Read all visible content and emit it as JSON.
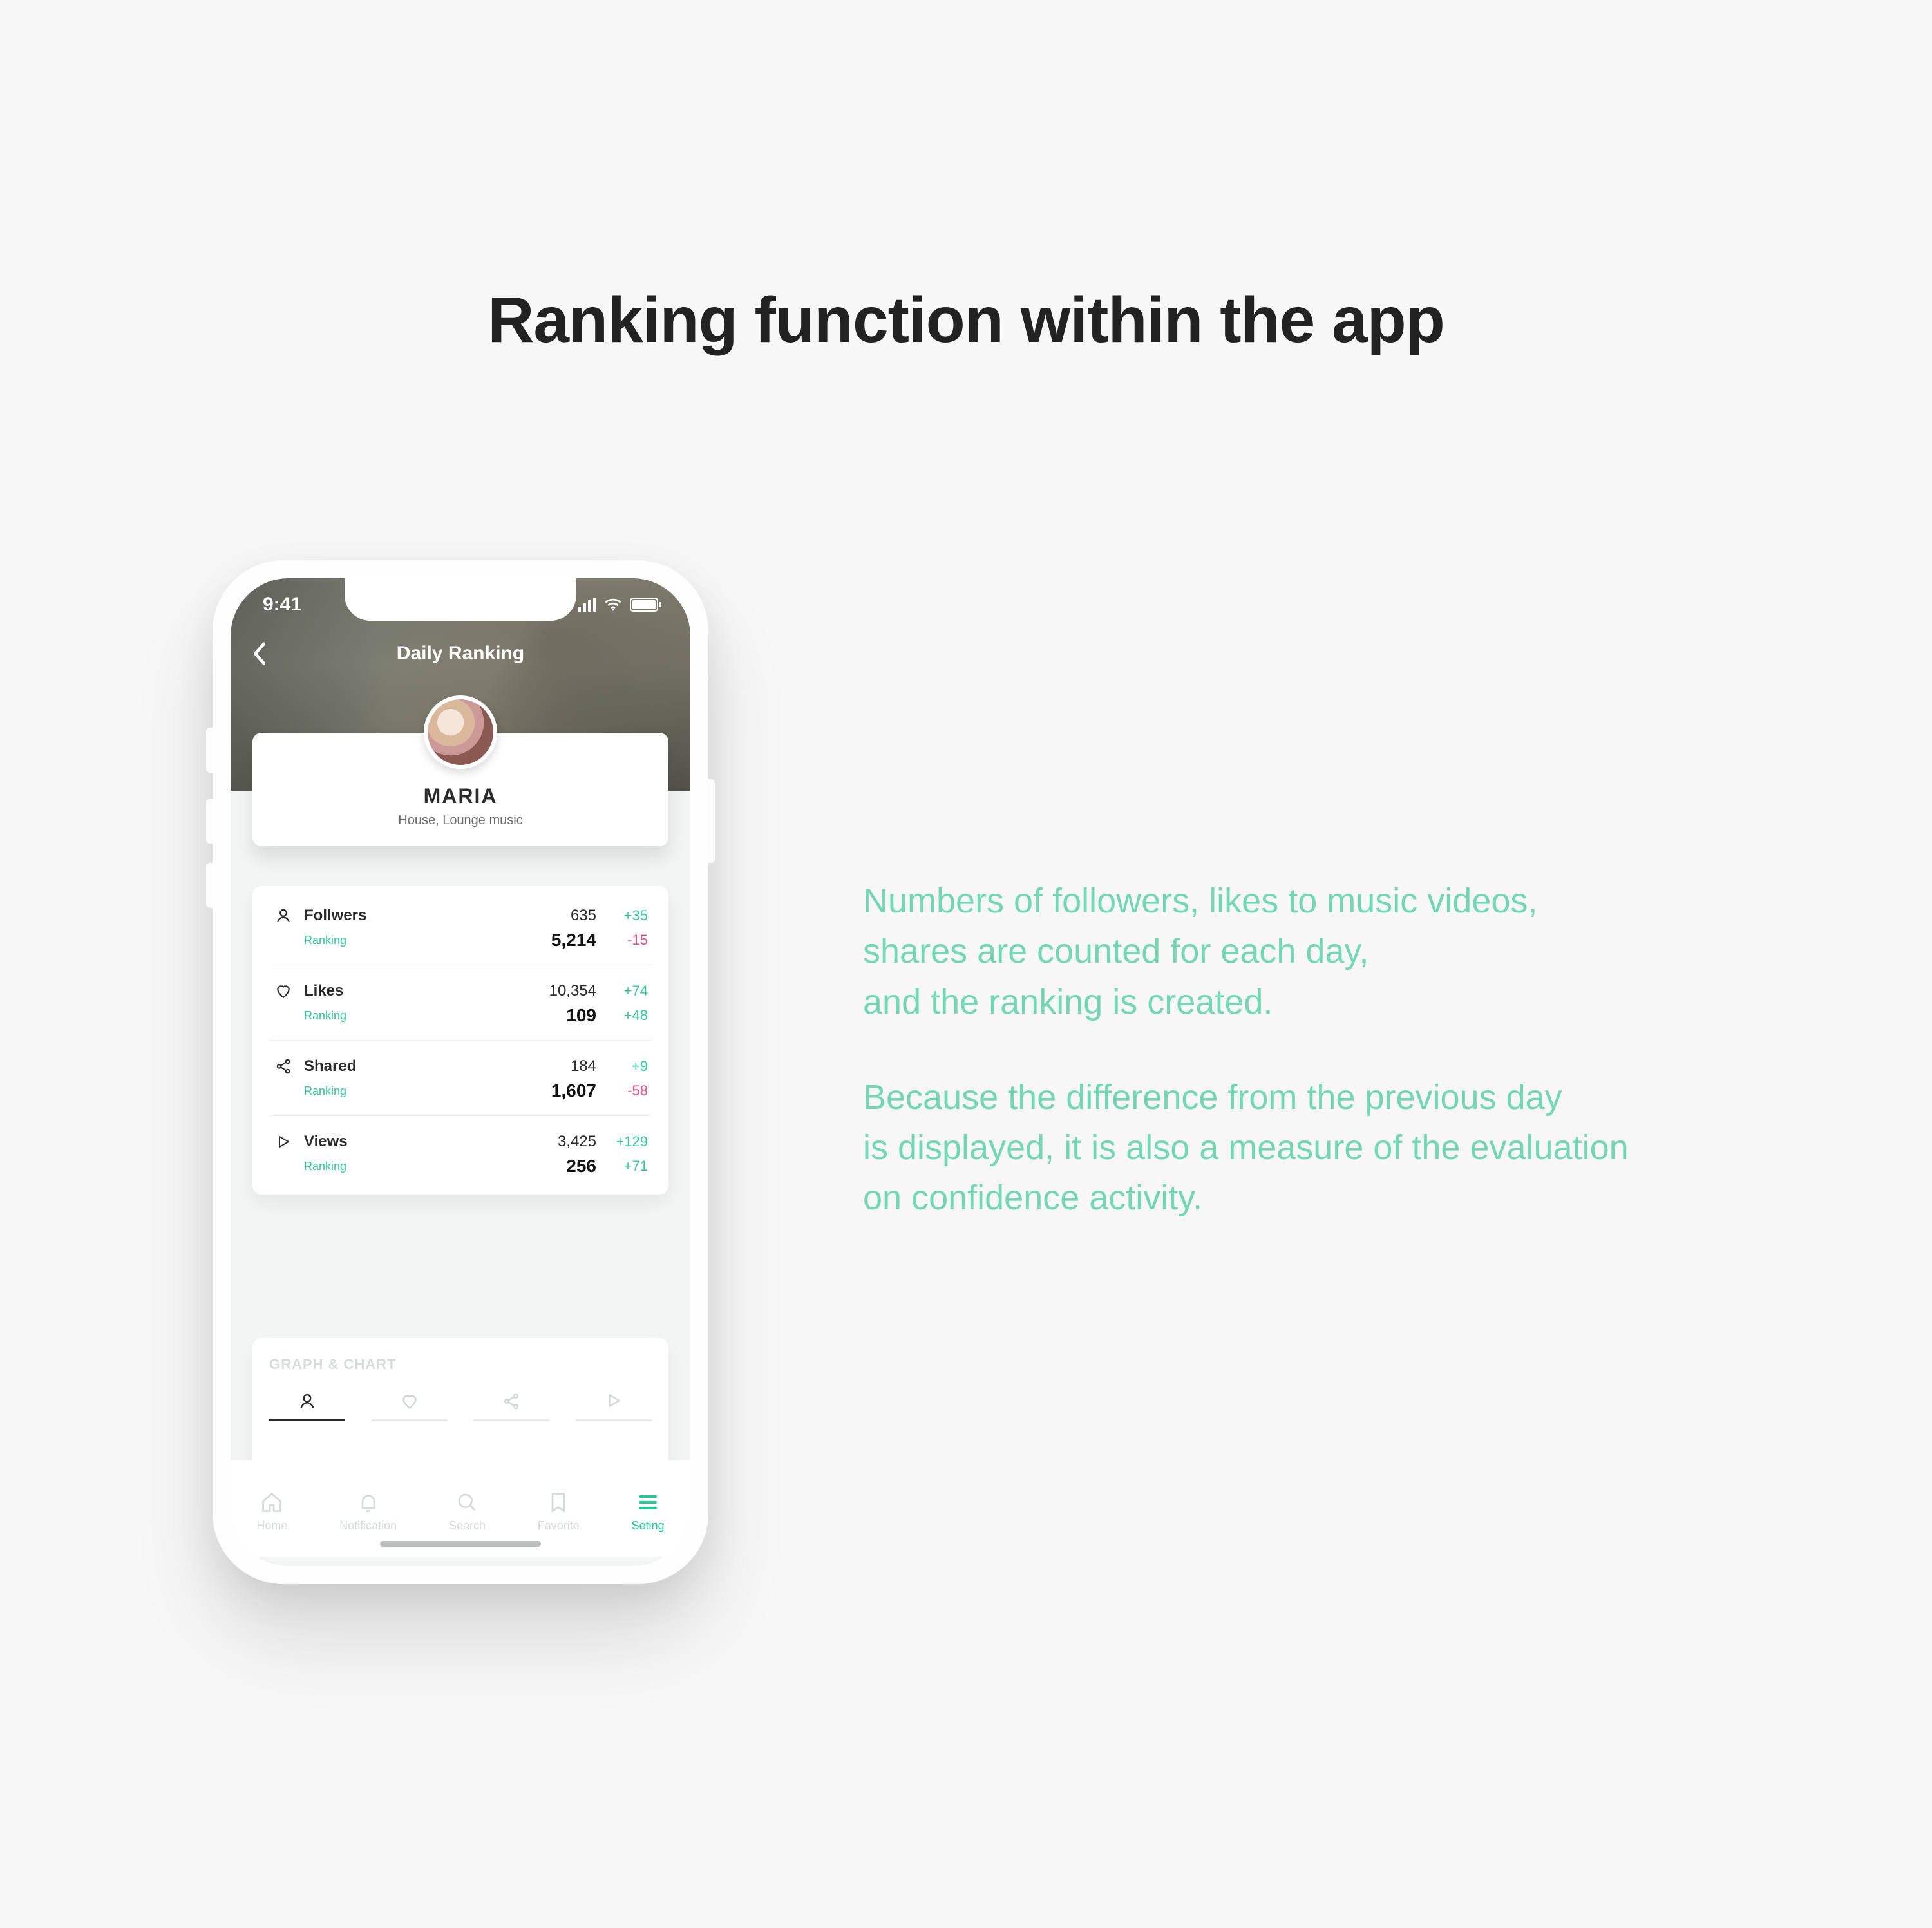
{
  "page_title": "Ranking function within the app",
  "description": {
    "p1": "Numbers of followers, likes to music videos,\nshares are counted for each day,\nand the ranking is created.",
    "p2": "Because the difference from the previous day\nis displayed, it is also a measure of the evaluation\non confidence activity."
  },
  "status_time": "9:41",
  "nav_title": "Daily Ranking",
  "profile": {
    "name": "MARIA",
    "subtitle": "House, Lounge music"
  },
  "ranking_label": "Ranking",
  "stats": [
    {
      "icon": "person",
      "label": "Follwers",
      "value": "635",
      "delta": "+35",
      "delta_dir": "up",
      "rank": "5,214",
      "rank_delta": "-15",
      "rank_dir": "down"
    },
    {
      "icon": "heart",
      "label": "Likes",
      "value": "10,354",
      "delta": "+74",
      "delta_dir": "up",
      "rank": "109",
      "rank_delta": "+48",
      "rank_dir": "up"
    },
    {
      "icon": "share",
      "label": "Shared",
      "value": "184",
      "delta": "+9",
      "delta_dir": "up",
      "rank": "1,607",
      "rank_delta": "-58",
      "rank_dir": "down"
    },
    {
      "icon": "play",
      "label": "Views",
      "value": "3,425",
      "delta": "+129",
      "delta_dir": "up",
      "rank": "256",
      "rank_delta": "+71",
      "rank_dir": "up"
    }
  ],
  "graph_title": "GRAPH & CHART",
  "bottom_nav": [
    {
      "label": "Home",
      "active": false
    },
    {
      "label": "Notification",
      "active": false
    },
    {
      "label": "Search",
      "active": false
    },
    {
      "label": "Favorite",
      "active": false
    },
    {
      "label": "Seting",
      "active": true
    }
  ]
}
